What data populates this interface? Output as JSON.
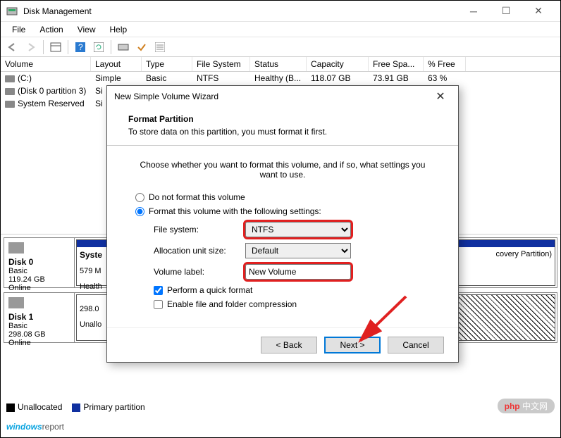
{
  "titlebar": {
    "title": "Disk Management"
  },
  "menubar": {
    "file": "File",
    "action": "Action",
    "view": "View",
    "help": "Help"
  },
  "columns": {
    "volume": "Volume",
    "layout": "Layout",
    "type": "Type",
    "fs": "File System",
    "status": "Status",
    "capacity": "Capacity",
    "free": "Free Spa...",
    "pfree": "% Free"
  },
  "volumes": [
    {
      "name": "(C:)",
      "layout": "Simple",
      "type": "Basic",
      "fs": "NTFS",
      "status": "Healthy (B...",
      "capacity": "118.07 GB",
      "free": "73.91 GB",
      "pfree": "63 %"
    },
    {
      "name": "(Disk 0 partition 3)",
      "layout": "Si",
      "type": "",
      "fs": "",
      "status": "",
      "capacity": "",
      "free": "",
      "pfree": ""
    },
    {
      "name": "System Reserved",
      "layout": "Si",
      "type": "",
      "fs": "",
      "status": "",
      "capacity": "",
      "free": "",
      "pfree": ""
    }
  ],
  "disks": [
    {
      "name": "Disk 0",
      "type": "Basic",
      "size": "119.24 GB",
      "status": "Online",
      "parts": [
        {
          "title": "Syste",
          "l2": "579 M",
          "l3": "Health"
        },
        {
          "title": "",
          "l2": "",
          "l3": "covery Partition)"
        }
      ]
    },
    {
      "name": "Disk 1",
      "type": "Basic",
      "size": "298.08 GB",
      "status": "Online",
      "parts": [
        {
          "title": "",
          "l2": "298.0",
          "l3": "Unallo"
        }
      ]
    }
  ],
  "legend": {
    "unalloc": "Unallocated",
    "primary": "Primary partition"
  },
  "wizard": {
    "title": "New Simple Volume Wizard",
    "heading": "Format Partition",
    "subheading": "To store data on this partition, you must format it first.",
    "instruction": "Choose whether you want to format this volume, and if so, what settings you want to use.",
    "opt_noformat": "Do not format this volume",
    "opt_format": "Format this volume with the following settings:",
    "lbl_fs": "File system:",
    "val_fs": "NTFS",
    "lbl_au": "Allocation unit size:",
    "val_au": "Default",
    "lbl_label": "Volume label:",
    "val_label": "New Volume",
    "chk_quick": "Perform a quick format",
    "chk_compress": "Enable file and folder compression",
    "btn_back": "< Back",
    "btn_next": "Next >",
    "btn_cancel": "Cancel"
  },
  "watermarks": {
    "left_win": "windows",
    "left_rep": "report",
    "right": "php 中文网"
  }
}
